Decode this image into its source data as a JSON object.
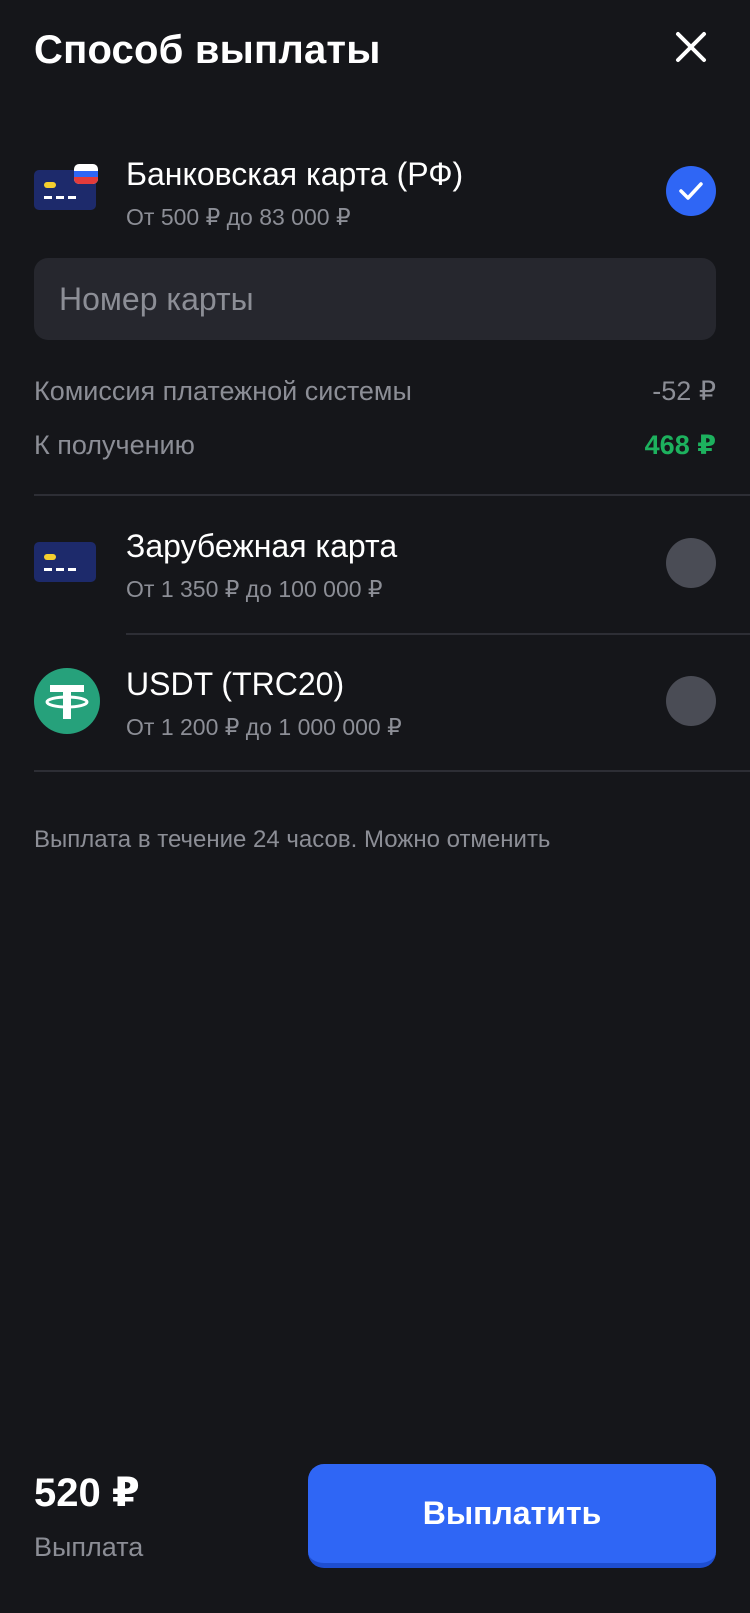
{
  "header": {
    "title": "Способ выплаты",
    "close_icon": "close-icon"
  },
  "options": [
    {
      "title": "Банковская карта (РФ)",
      "range": "От 500 ₽ до 83 000 ₽",
      "icon": "bank-card-ru-icon",
      "selected": true
    },
    {
      "title": "Зарубежная карта",
      "range": "От 1 350 ₽ до 100 000 ₽",
      "icon": "bank-card-icon",
      "selected": false
    },
    {
      "title": "USDT (TRC20)",
      "range": "От 1 200 ₽ до 1 000 000 ₽",
      "icon": "tether-icon",
      "selected": false
    }
  ],
  "card_input": {
    "placeholder": "Номер карты",
    "value": ""
  },
  "fees": {
    "commission_label": "Комиссия платежной системы",
    "commission_value": "-52 ₽",
    "receive_label": "К получению",
    "receive_value": "468 ₽"
  },
  "note": "Выплата в течение 24 часов. Можно отменить",
  "footer": {
    "amount": "520 ₽",
    "amount_label": "Выплата",
    "pay_button": "Выплатить"
  },
  "colors": {
    "background": "#15161a",
    "accent": "#2f66f5",
    "success": "#1db15e",
    "radio_off": "#4a4c55",
    "card_icon": "#1d2a6b",
    "card_chip": "#f6cf2e",
    "tether": "#26a17b"
  }
}
